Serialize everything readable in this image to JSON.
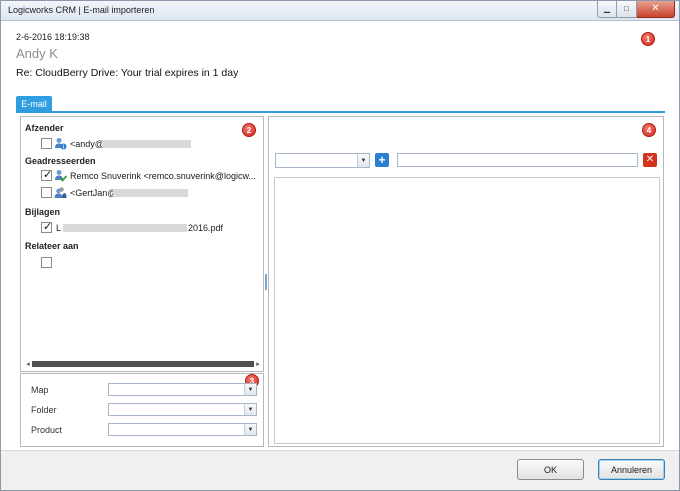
{
  "window": {
    "title": "Logicworks CRM  | E-mail importeren",
    "minimize_glyph": "▁",
    "maximize_glyph": "□",
    "close_glyph": "✕"
  },
  "email": {
    "timestamp": "2-6-2016 18:19:38",
    "sender_name": "Andy K",
    "subject": "Re: CloudBerry Drive: Your trial expires in 1 day"
  },
  "badges": [
    "1",
    "2",
    "3",
    "4"
  ],
  "tabs": [
    {
      "label": "E-mail",
      "active": true
    }
  ],
  "left_panel": {
    "sections": {
      "afzender": "Afzender",
      "geadresseerden": "Geadresseerden",
      "bijlagen": "Bijlagen",
      "relateer": "Relateer aan"
    },
    "afzender_items": [
      {
        "text": "<andy@",
        "checked": false,
        "icon": "contact-info-icon"
      }
    ],
    "geadresseerden_items": [
      {
        "text": "Remco  Snuverink  <remco.snuverink@logicw...",
        "checked": true,
        "icon": "contact-check-icon"
      },
      {
        "text": "<GertJan@",
        "checked": false,
        "icon": "contact-group-icon"
      }
    ],
    "bijlagen_items": [
      {
        "prefix": "L",
        "suffix": "2016.pdf",
        "checked": true
      }
    ],
    "relateer_items": [
      {
        "checked": false
      }
    ]
  },
  "form": {
    "map_label": "Map",
    "folder_label": "Folder",
    "product_label": "Product",
    "map_value": "",
    "folder_value": "",
    "product_value": ""
  },
  "right_panel": {
    "dropdown_value": "",
    "search_value": ""
  },
  "buttons": {
    "ok": "OK",
    "cancel": "Annuleren",
    "add": "+",
    "delete": "✕",
    "dropdown_arrow": "▼",
    "scroll_left": "◂",
    "scroll_right": "▸"
  },
  "colors": {
    "accent": "#2f9ee1",
    "badge": "#d0261c",
    "add_button": "#2a7fd0",
    "delete_button": "#d2331d"
  }
}
